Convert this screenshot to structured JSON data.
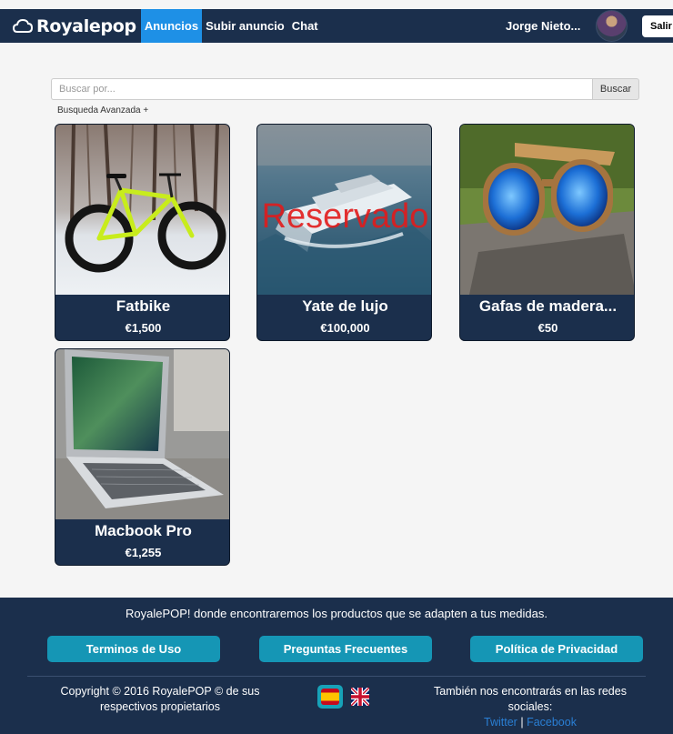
{
  "nav": {
    "brand": "Royalepop",
    "links": [
      "Anuncios",
      "Subir anuncio",
      "Chat"
    ],
    "user_name": "Jorge Nieto...",
    "logout_label": "Salir"
  },
  "search": {
    "placeholder": "Buscar por...",
    "button_label": "Buscar",
    "advanced_label": "Busqueda Avanzada +"
  },
  "products": [
    {
      "title": "Fatbike",
      "price": "€1,500",
      "image_icon": "bike-photo"
    },
    {
      "title": "Yate de lujo",
      "price": "€100,000",
      "image_icon": "yacht-photo",
      "overlay": "Reservado"
    },
    {
      "title": "Gafas de madera...",
      "price": "€50",
      "image_icon": "sunglasses-photo"
    },
    {
      "title": "Macbook Pro",
      "price": "€1,255",
      "image_icon": "laptop-photo"
    }
  ],
  "footer": {
    "tagline": "RoyalePOP! donde encontraremos los productos que se adapten a tus medidas.",
    "buttons": [
      "Terminos de Uso",
      "Preguntas Frecuentes",
      "Política de Privacidad"
    ],
    "copyright": "Copyright © 2016 RoyalePOP © de sus respectivos propietarios",
    "social_text": "También nos encontrarás en las redes sociales:",
    "social_links": [
      "Twitter",
      "Facebook"
    ],
    "social_separator": "|",
    "languages": [
      "es-flag-icon",
      "uk-flag-icon"
    ]
  },
  "colors": {
    "navy": "#1b2f4c",
    "active_blue": "#1e90e6",
    "teal_button": "#1596b5",
    "reserved_red": "#e21b1b"
  }
}
